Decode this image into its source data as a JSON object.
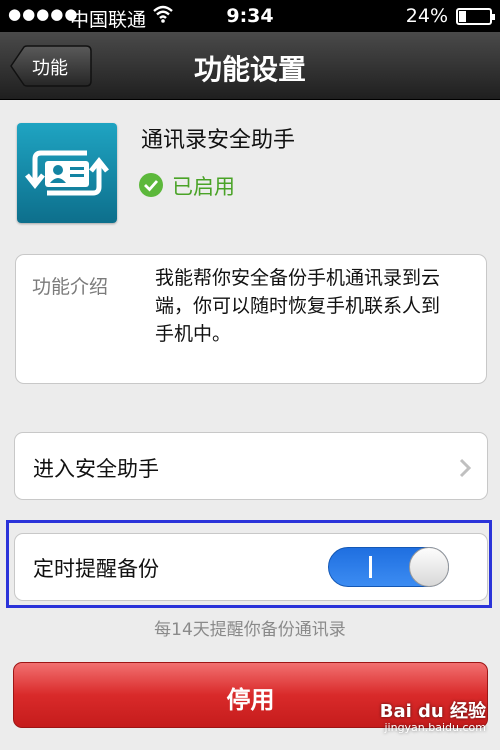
{
  "status_bar": {
    "signal": "●●●●●",
    "carrier": "中国联通",
    "time": "9:34",
    "battery_percent": "24%",
    "battery_level": 0.24
  },
  "nav": {
    "back_label": "功能",
    "title": "功能设置"
  },
  "app": {
    "name": "通讯录安全助手",
    "status": "已启用",
    "status_color": "#4aa327",
    "icon": "contacts-sync-icon"
  },
  "intro": {
    "label": "功能介绍",
    "text": "我能帮你安全备份手机通讯录到云端，你可以随时恢复手机联系人到手机中。"
  },
  "enter_row": {
    "label": "进入安全助手"
  },
  "reminder": {
    "label": "定时提醒备份",
    "enabled": true,
    "hint": "每14天提醒你备份通讯录",
    "highlight_color": "#2b33d9"
  },
  "disable_button": {
    "label": "停用",
    "color": "#d92a2a"
  },
  "watermark": {
    "brand": "Bai du 经验",
    "url": "jingyan.baidu.com"
  }
}
